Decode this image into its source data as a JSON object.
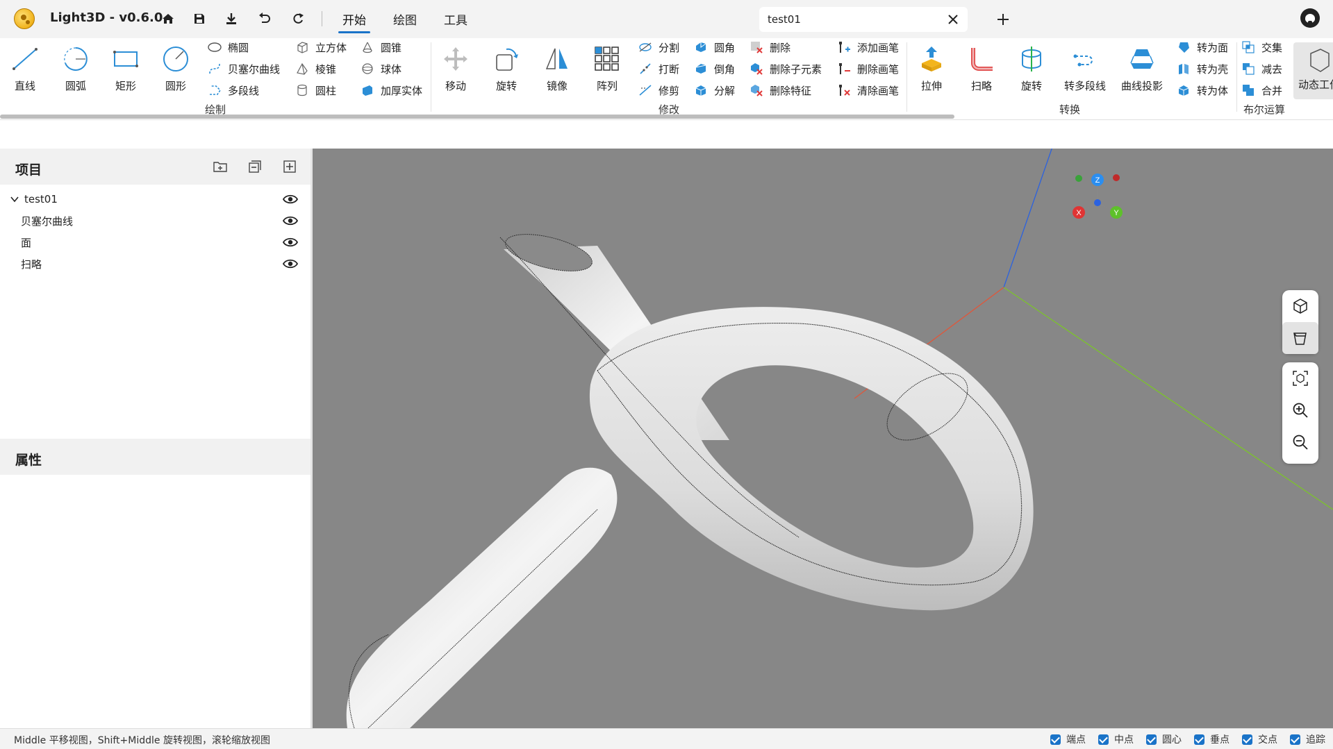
{
  "app": {
    "title": "Light3D - v0.6.0"
  },
  "menu": {
    "tabs": [
      {
        "label": "开始"
      },
      {
        "label": "绘图"
      },
      {
        "label": "工具"
      }
    ]
  },
  "document_tab": {
    "name": "test01"
  },
  "ribbon": {
    "draw": {
      "group_label": "绘制",
      "big": [
        {
          "label": "直线"
        },
        {
          "label": "圆弧"
        },
        {
          "label": "矩形"
        },
        {
          "label": "圆形"
        }
      ],
      "small": [
        {
          "label": "椭圆"
        },
        {
          "label": "贝塞尔曲线"
        },
        {
          "label": "多段线"
        },
        {
          "label": "立方体"
        },
        {
          "label": "棱锥"
        },
        {
          "label": "圆柱"
        },
        {
          "label": "圆锥"
        },
        {
          "label": "球体"
        },
        {
          "label": "加厚实体"
        }
      ]
    },
    "modify": {
      "group_label": "修改",
      "big": [
        {
          "label": "移动"
        },
        {
          "label": "旋转"
        },
        {
          "label": "镜像"
        },
        {
          "label": "阵列"
        }
      ],
      "small": [
        {
          "label": "分割"
        },
        {
          "label": "打断"
        },
        {
          "label": "修剪"
        },
        {
          "label": "圆角"
        },
        {
          "label": "倒角"
        },
        {
          "label": "分解"
        },
        {
          "label": "删除"
        },
        {
          "label": "删除子元素"
        },
        {
          "label": "删除特征"
        },
        {
          "label": "添加画笔"
        },
        {
          "label": "删除画笔"
        },
        {
          "label": "清除画笔"
        }
      ]
    },
    "convert": {
      "group_label": "转换",
      "big": [
        {
          "label": "拉伸"
        },
        {
          "label": "扫略"
        },
        {
          "label": "旋转"
        },
        {
          "label": "转多段线"
        },
        {
          "label": "曲线投影"
        }
      ],
      "small": [
        {
          "label": "转为面"
        },
        {
          "label": "转为壳"
        },
        {
          "label": "转为体"
        }
      ]
    },
    "boolean": {
      "group_label": "布尔运算",
      "small": [
        {
          "label": "交集"
        },
        {
          "label": "减去"
        },
        {
          "label": "合并"
        }
      ]
    },
    "dynamic": {
      "label": "动态工作"
    }
  },
  "project_panel": {
    "title": "项目",
    "root": {
      "label": "test01"
    },
    "items": [
      {
        "label": "贝塞尔曲线"
      },
      {
        "label": "面"
      },
      {
        "label": "扫略"
      }
    ]
  },
  "properties_panel": {
    "title": "属性"
  },
  "gizmo": {
    "z": "Z",
    "x": "X",
    "y": "Y"
  },
  "statusbar": {
    "hint": "Middle 平移视图，Shift+Middle 旋转视图，滚轮缩放视图",
    "snaps": [
      {
        "label": "端点"
      },
      {
        "label": "中点"
      },
      {
        "label": "圆心"
      },
      {
        "label": "垂点"
      },
      {
        "label": "交点"
      },
      {
        "label": "追踪"
      }
    ]
  },
  "colors": {
    "accent": "#1a73c8",
    "viewport_bg": "#878787",
    "axis_x": "#e0563a",
    "axis_y": "#7cc42a",
    "axis_z": "#2b62e0"
  }
}
